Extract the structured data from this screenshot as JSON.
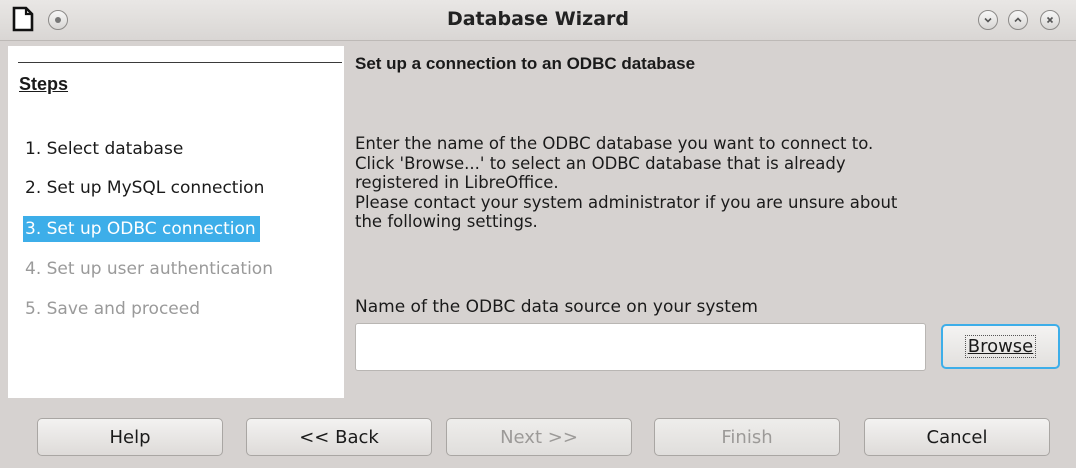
{
  "window": {
    "title": "Database Wizard"
  },
  "steps": {
    "heading": "Steps",
    "items": [
      {
        "label": "1. Select database",
        "state": "done"
      },
      {
        "label": "2. Set up MySQL connection",
        "state": "done"
      },
      {
        "label": "3. Set up ODBC connection",
        "state": "active"
      },
      {
        "label": "4. Set up user authentication",
        "state": "disabled"
      },
      {
        "label": "5. Save and proceed",
        "state": "disabled"
      }
    ]
  },
  "main": {
    "heading": "Set up a connection to an ODBC database",
    "description_lines": [
      "Enter the name of the ODBC database you want to connect to.",
      "Click 'Browse...' to select an ODBC database that is already",
      "registered in LibreOffice.",
      "Please contact your system administrator if you are unsure about",
      "the following settings."
    ],
    "field_label": "Name of the ODBC data source on your system",
    "field_value": "",
    "browse_label": "Browse"
  },
  "buttons": {
    "help": "Help",
    "back": "<< Back",
    "next": "Next >>",
    "finish": "Finish",
    "cancel": "Cancel"
  },
  "colors": {
    "accent": "#3daee9",
    "background": "#d6d2d0",
    "disabled_text": "#9a9a9a"
  }
}
